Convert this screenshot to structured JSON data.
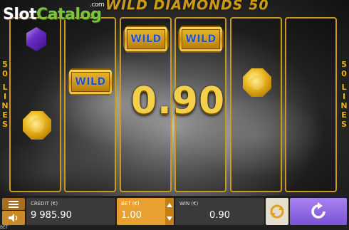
{
  "watermark": {
    "brand_part1": "Slot",
    "brand_part2": "Catalog",
    "brand_suffix": ".com"
  },
  "game": {
    "title": "WILD DIAMONDS 50",
    "lines_vertical": [
      "5",
      "0",
      "",
      "L",
      "I",
      "N",
      "E",
      "S"
    ]
  },
  "reels": {
    "wild_text": "WILD",
    "win_amount": "0.90",
    "symbols": {
      "reel1": [
        "purple-gem",
        "",
        "gold-gem",
        "",
        ""
      ],
      "reel2": [
        "",
        "wild",
        "",
        "",
        ""
      ],
      "reel3": [
        "wild",
        "",
        "",
        "",
        ""
      ],
      "reel4": [
        "wild",
        "",
        "",
        "",
        ""
      ],
      "reel5": [
        "",
        "gold-gem",
        "",
        "",
        ""
      ],
      "reel6": [
        "",
        "",
        "",
        "",
        ""
      ]
    }
  },
  "controls": {
    "credit_label": "CREDIT (€)",
    "credit_value": "9 985.90",
    "bet_label": "BET (€)",
    "bet_value": "1.00",
    "win_label": "WIN (€)",
    "win_value": "0.90",
    "bottom_tag": "BET"
  },
  "colors": {
    "gold": "#c99a1c",
    "bet_panel": "#e8a130",
    "spin_button": "#8e69e3",
    "wild_text": "#1f4fc4"
  }
}
